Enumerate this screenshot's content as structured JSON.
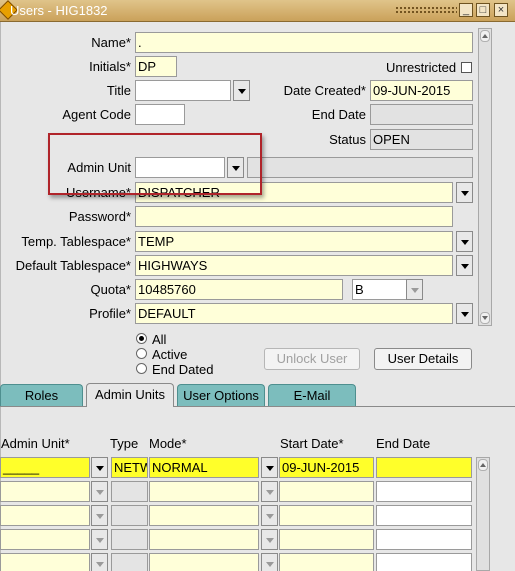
{
  "window": {
    "title": "Users - HIG1832",
    "min_label": "_",
    "max_label": "□",
    "close_label": "×"
  },
  "form": {
    "name": {
      "label": "Name*",
      "value": "."
    },
    "initials": {
      "label": "Initials*",
      "value": "DP"
    },
    "unrestricted": {
      "label": "Unrestricted",
      "checked": false
    },
    "title": {
      "label": "Title",
      "value": ""
    },
    "date_created": {
      "label": "Date Created*",
      "value": "09-JUN-2015"
    },
    "agent_code": {
      "label": "Agent Code",
      "value": ""
    },
    "end_date": {
      "label": "End Date",
      "value": ""
    },
    "status": {
      "label": "Status",
      "value": "OPEN"
    },
    "admin_unit": {
      "label": "Admin Unit",
      "value": "",
      "description": ""
    },
    "username": {
      "label": "Username*",
      "value": "DISPATCHER"
    },
    "password": {
      "label": "Password*",
      "value": ""
    },
    "temp_tablespace": {
      "label": "Temp. Tablespace*",
      "value": "TEMP"
    },
    "default_tablespace": {
      "label": "Default Tablespace*",
      "value": "HIGHWAYS"
    },
    "quota": {
      "label": "Quota*",
      "value": "10485760",
      "unit": "B"
    },
    "profile": {
      "label": "Profile*",
      "value": "DEFAULT"
    }
  },
  "filter": {
    "options": [
      "All",
      "Active",
      "End Dated"
    ],
    "selected": "All"
  },
  "buttons": {
    "unlock_user": "Unlock User",
    "user_details": "User Details"
  },
  "tabs": [
    {
      "label": "Roles",
      "active": false
    },
    {
      "label": "Admin Units",
      "active": true
    },
    {
      "label": "User Options",
      "active": false
    },
    {
      "label": "E-Mail",
      "active": false
    }
  ],
  "grid": {
    "headers": {
      "admin_unit": "Admin Unit*",
      "type": "Type",
      "mode": "Mode*",
      "start_date": "Start Date*",
      "end_date": "End Date"
    },
    "rows": [
      {
        "admin_unit": "_____",
        "type": "NETW",
        "mode": "NORMAL",
        "start_date": "09-JUN-2015",
        "end_date": ""
      },
      {
        "admin_unit": "",
        "type": "",
        "mode": "",
        "start_date": "",
        "end_date": ""
      },
      {
        "admin_unit": "",
        "type": "",
        "mode": "",
        "start_date": "",
        "end_date": ""
      },
      {
        "admin_unit": "",
        "type": "",
        "mode": "",
        "start_date": "",
        "end_date": ""
      },
      {
        "admin_unit": "",
        "type": "",
        "mode": "",
        "start_date": "",
        "end_date": ""
      }
    ]
  },
  "colors": {
    "field_bg": "#ffffd9",
    "current_row": "#ffff2a",
    "tab_bg": "#7cbdbd",
    "highlight_border": "#b0242a"
  }
}
